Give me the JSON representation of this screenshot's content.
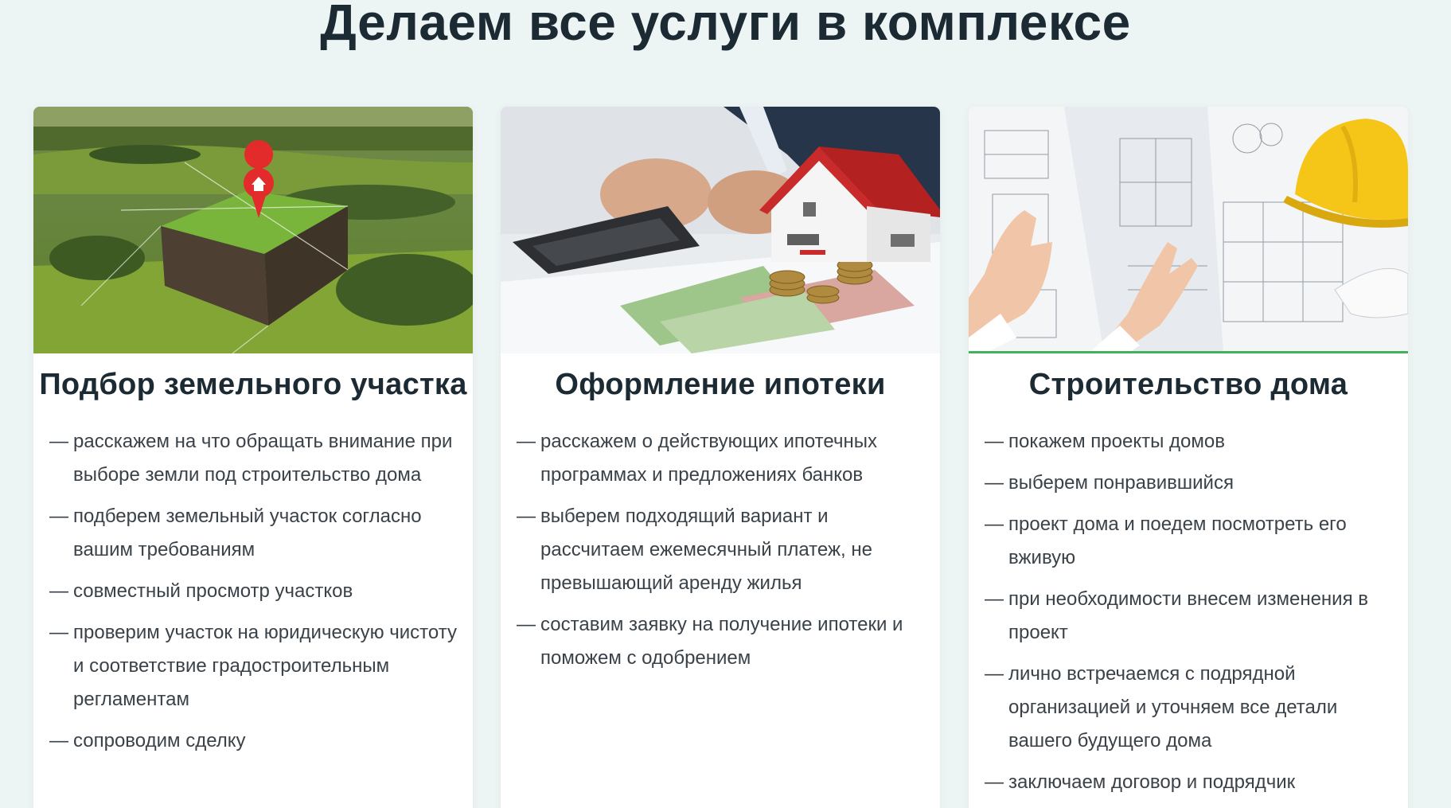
{
  "section": {
    "title": "Делаем все услуги в комплексе"
  },
  "cards": [
    {
      "title": "Подбор земельного участка",
      "image": "aerial-land-plot-with-pin",
      "items": [
        "расскажем на что обращать внимание при выборе земли под строительство дома",
        "подберем земельный участок согласно вашим требованиям",
        "совместный просмотр участков",
        "проверим участок на юридическую чистоту и соответствие градостроительным регламентам",
        "сопроводим сделку"
      ]
    },
    {
      "title": "Оформление ипотеки",
      "image": "house-model-coins-calculator",
      "items": [
        "расскажем о действующих ипотечных программах и предложениях банков",
        "выберем подходящий вариант и рассчитаем ежемесячный платеж, не превышающий аренду жилья",
        "составим заявку на получение ипотеки и поможем с одобрением"
      ]
    },
    {
      "title": "Строительство дома",
      "image": "blueprints-and-hardhat",
      "items": [
        "покажем проекты домов",
        "выберем понравившийся",
        "проект дома и поедем посмотреть его вживую",
        "при необходимости внесем изменения в проект",
        "лично встречаемся с подрядной организацией и уточняем все детали вашего будущего дома",
        "заключаем договор и подрядчик"
      ]
    }
  ],
  "list_marker": "—",
  "colors": {
    "background": "#edf4f4",
    "card": "#ffffff",
    "heading": "#1c2a33",
    "text": "#3a4249",
    "accent": "#43b05c"
  }
}
